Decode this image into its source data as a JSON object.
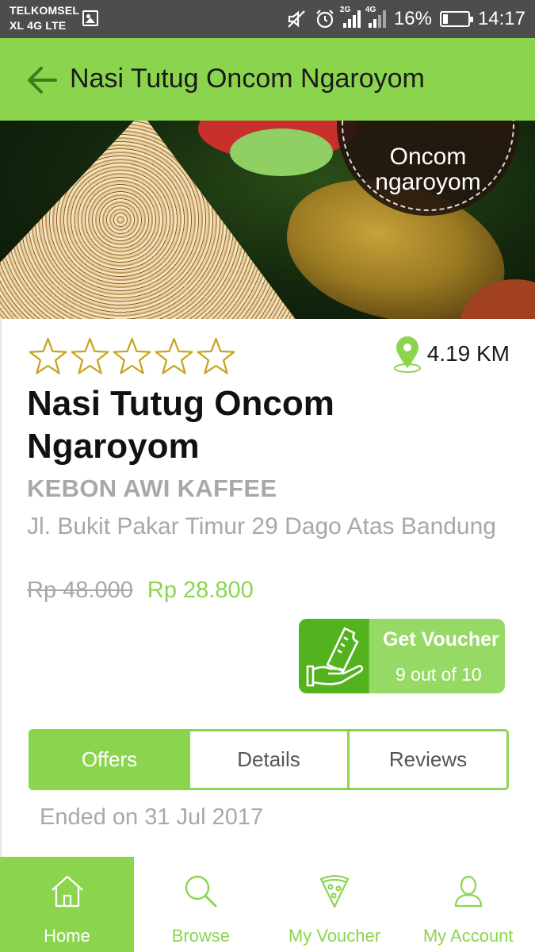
{
  "status_bar": {
    "carrier_line1": "TELKOMSEL",
    "carrier_line2": "XL 4G LTE",
    "network_a": "2G",
    "network_b": "4G",
    "battery": "16%",
    "time": "14:17"
  },
  "app_bar": {
    "title": "Nasi Tutug Oncom Ngaroyom",
    "back_icon": "arrow-left-icon",
    "color": "#8bd54e"
  },
  "hero": {
    "badge_line1": "Oncom",
    "badge_line2": "ngaroyom"
  },
  "deal": {
    "rating_stars": 0,
    "rating_max": 5,
    "distance": "4.19 KM",
    "title": "Nasi Tutug Oncom Ngaroyom",
    "merchant": "KEBON AWI KAFFEE",
    "address": "Jl. Bukit Pakar Timur 29 Dago Atas Bandung",
    "old_price": "Rp 48.000",
    "new_price": "Rp 28.800"
  },
  "voucher": {
    "label": "Get Voucher",
    "count": "9 out of 10",
    "icon": "hand-ticket-icon"
  },
  "tabs": [
    {
      "label": "Offers",
      "active": true
    },
    {
      "label": "Details",
      "active": false
    },
    {
      "label": "Reviews",
      "active": false
    }
  ],
  "offer_status": "Ended on 31 Jul 2017",
  "bottom_nav": [
    {
      "label": "Home",
      "icon": "home-icon",
      "active": true
    },
    {
      "label": "Browse",
      "icon": "search-icon",
      "active": false
    },
    {
      "label": "My Voucher",
      "icon": "pizza-icon",
      "active": false
    },
    {
      "label": "My Account",
      "icon": "user-icon",
      "active": false
    }
  ],
  "colors": {
    "accent": "#8bd54e",
    "accent_dark": "#55b21f",
    "star_outline": "#c9a21a",
    "muted_text": "#a8a8a8"
  }
}
